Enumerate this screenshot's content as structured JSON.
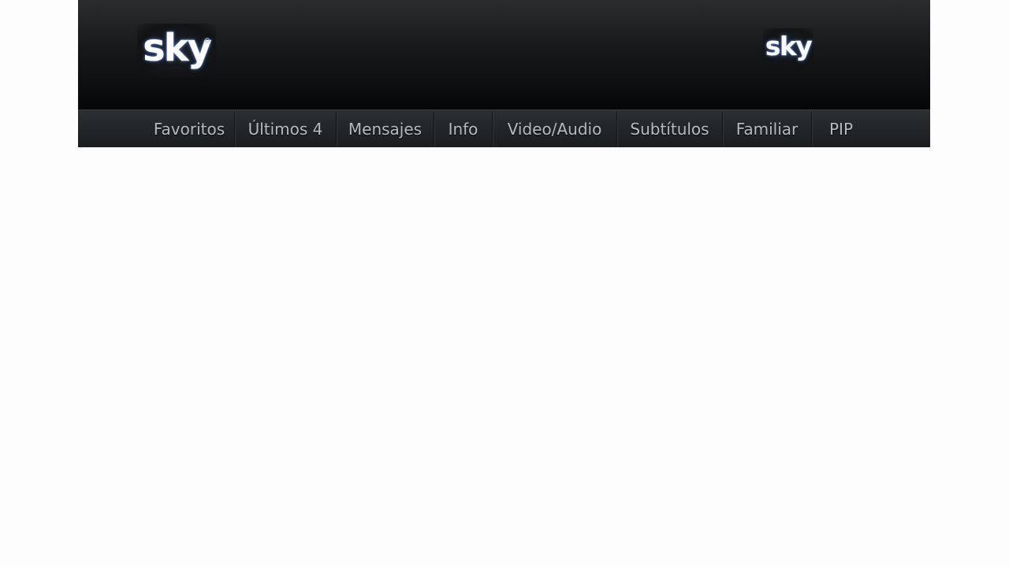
{
  "header": {
    "logo_left": "sky",
    "logo_right": "sky"
  },
  "nav": {
    "items": [
      {
        "label": "Favoritos"
      },
      {
        "label": "Últimos 4"
      },
      {
        "label": "Mensajes"
      },
      {
        "label": "Info"
      },
      {
        "label": "Video/Audio"
      },
      {
        "label": "Subtítulos"
      },
      {
        "label": "Familiar"
      },
      {
        "label": "PIP"
      }
    ]
  },
  "colors": {
    "header_background": "#0a0b0c",
    "nav_text": "#b9bcbf",
    "page_background": "#fdfdfd"
  }
}
